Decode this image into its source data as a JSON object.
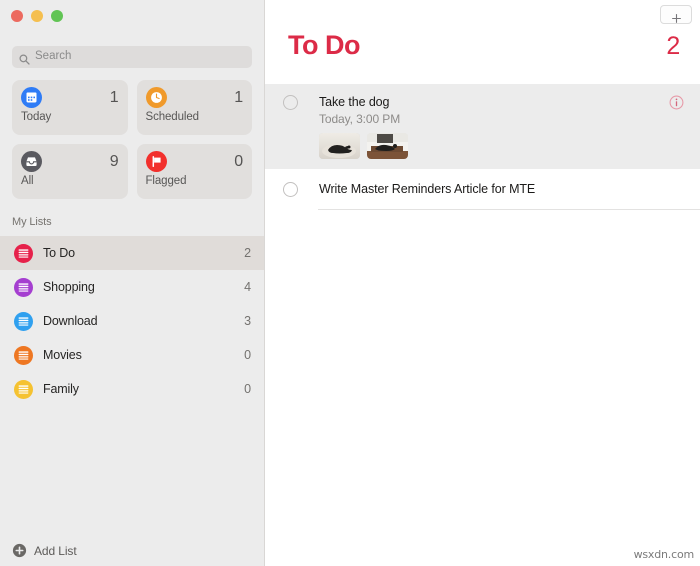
{
  "window": {
    "traffic_lights": [
      "close",
      "minimize",
      "zoom"
    ],
    "colors": {
      "close": "#ec6a5f",
      "minimize": "#f5bf4f",
      "zoom": "#61c454",
      "accent_red": "#dc2b47"
    }
  },
  "sidebar": {
    "search": {
      "placeholder": "Search",
      "value": "",
      "icon": "search-icon"
    },
    "smart_lists": [
      {
        "label": "Today",
        "count": "1",
        "icon": "calendar-icon",
        "color": "#2f7cf6"
      },
      {
        "label": "Scheduled",
        "count": "1",
        "icon": "clock-icon",
        "color": "#f09a2b"
      },
      {
        "label": "All",
        "count": "9",
        "icon": "inbox-icon",
        "color": "#5a5a60"
      },
      {
        "label": "Flagged",
        "count": "0",
        "icon": "flag-icon",
        "color": "#f2302c"
      }
    ],
    "my_lists_header": "My Lists",
    "lists": [
      {
        "label": "To Do",
        "count": "2",
        "color": "#e6214a",
        "selected": true
      },
      {
        "label": "Shopping",
        "count": "4",
        "color": "#a53ed0",
        "selected": false
      },
      {
        "label": "Download",
        "count": "3",
        "color": "#2fa0ef",
        "selected": false
      },
      {
        "label": "Movies",
        "count": "0",
        "color": "#ee7722",
        "selected": false
      },
      {
        "label": "Family",
        "count": "0",
        "color": "#f5c231",
        "selected": false
      }
    ],
    "add_list": {
      "label": "Add List",
      "icon": "plus-circle-icon"
    }
  },
  "content": {
    "add_button_icon": "plus-icon",
    "title": "To Do",
    "total_count": "2",
    "reminders": [
      {
        "title": "Take the dog",
        "subtitle": "Today, 3:00 PM",
        "has_info": true,
        "info_icon": "info-circle-icon",
        "attachments": [
          "dog-lying-photo",
          "dog-on-couch-photo"
        ]
      },
      {
        "title": "Write Master Reminders Article for MTE",
        "subtitle": "",
        "has_info": false,
        "attachments": []
      }
    ]
  },
  "watermark": "wsxdn.com"
}
